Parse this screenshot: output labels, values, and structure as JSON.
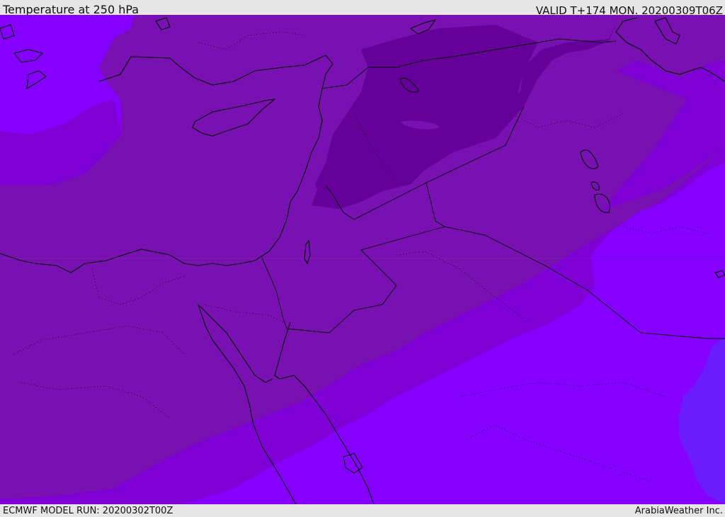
{
  "header": {
    "title": "Temperature at 250 hPa",
    "valid": "VALID T+174 MON. 20200309T06Z"
  },
  "footer": {
    "model_run": "ECMWF MODEL RUN: 20200302T00Z",
    "provider": "ArabiaWeather Inc."
  },
  "colors": {
    "band_coldest": "#640099",
    "band_cold": "#7910b1",
    "band_mid": "#7f00d7",
    "band_warm": "#8500ff",
    "band_warmest": "#6a1cff",
    "coastline": "#000000",
    "frame": "#e6e6e6"
  }
}
